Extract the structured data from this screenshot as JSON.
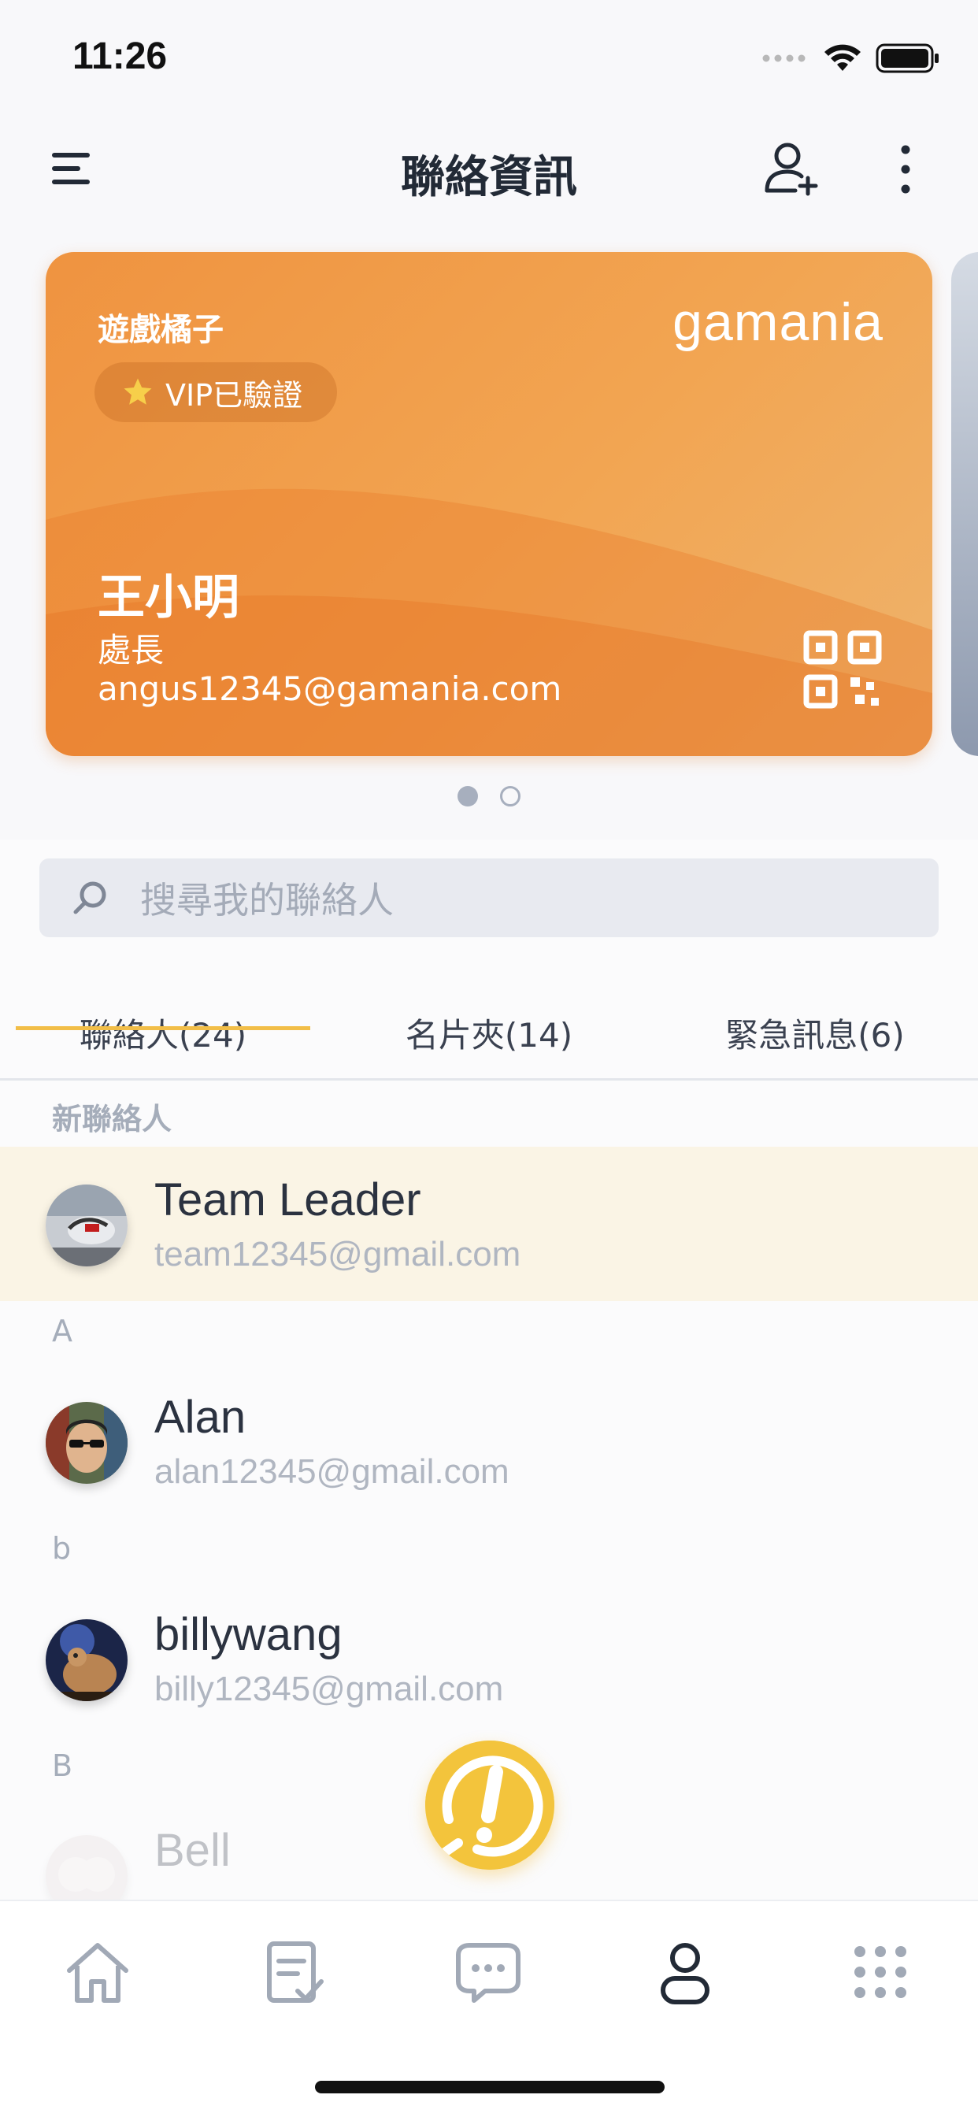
{
  "status_bar": {
    "time": "11:26"
  },
  "header": {
    "title": "聯絡資訊"
  },
  "card": {
    "company": "遊戲橘子",
    "logo_text": "gamania",
    "badge": "VIP已驗證",
    "name": "王小明",
    "job_title": "處長",
    "email": "angus12345@gamania.com"
  },
  "carousel": {
    "page_count": 2,
    "active_index": 0
  },
  "search": {
    "placeholder": "搜尋我的聯絡人"
  },
  "tabs": [
    {
      "label": "聯絡人(24)",
      "active": true
    },
    {
      "label": "名片夾(14)",
      "active": false
    },
    {
      "label": "緊急訊息(6)",
      "active": false
    }
  ],
  "sections": [
    {
      "header": "新聯絡人",
      "contacts": [
        {
          "name": "Team Leader",
          "email": "team12345@gmail.com",
          "highlighted": true
        }
      ]
    },
    {
      "header": "A",
      "contacts": [
        {
          "name": "Alan",
          "email": "alan12345@gmail.com"
        }
      ]
    },
    {
      "header": "b",
      "contacts": [
        {
          "name": "billywang",
          "email": "billy12345@gmail.com"
        }
      ]
    },
    {
      "header": "B",
      "contacts": [
        {
          "name": "Bell",
          "email": ""
        }
      ]
    }
  ],
  "bottom_nav": [
    {
      "icon": "home-icon",
      "active": false
    },
    {
      "icon": "checklist-icon",
      "active": false
    },
    {
      "icon": "chat-icon",
      "active": false
    },
    {
      "icon": "person-icon",
      "active": true
    },
    {
      "icon": "grid-icon",
      "active": false
    }
  ],
  "colors": {
    "accent": "#f2be48",
    "card_orange": "#ef9340",
    "emergency_yellow": "#f3c43c",
    "highlight_row": "#faf4e5"
  }
}
